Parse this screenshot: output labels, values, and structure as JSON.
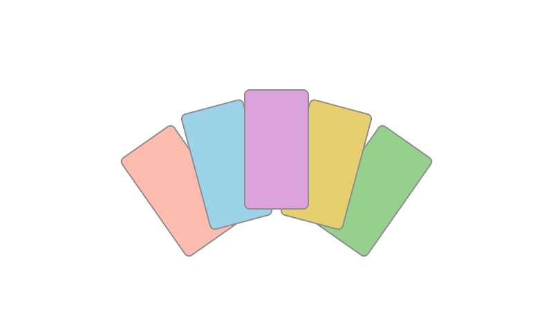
{
  "hand": {
    "cards": [
      {
        "id": "card-1",
        "color": "#fdbcae"
      },
      {
        "id": "card-2",
        "color": "#9dd3e8"
      },
      {
        "id": "card-3",
        "color": "#dca2dc"
      },
      {
        "id": "card-4",
        "color": "#e7cf6e"
      },
      {
        "id": "card-5",
        "color": "#95d18c"
      }
    ]
  }
}
